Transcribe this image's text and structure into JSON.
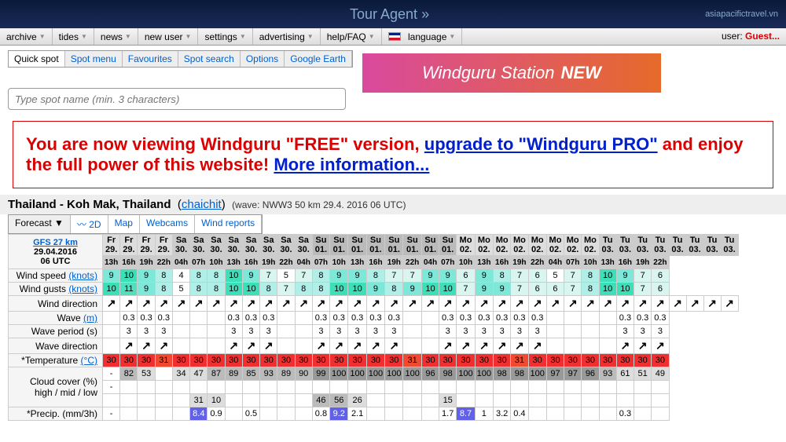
{
  "top": {
    "tour": "Tour Agent »",
    "sponsor": "asiapacifictravel.vn"
  },
  "menu": {
    "items": [
      "archive",
      "tides",
      "news",
      "new user",
      "settings",
      "advertising",
      "help/FAQ"
    ],
    "lang": "language",
    "user_label": "user: ",
    "guest": "Guest..."
  },
  "tabs": [
    "Quick spot",
    "Spot menu",
    "Favourites",
    "Spot search",
    "Options",
    "Google Earth"
  ],
  "search": {
    "placeholder": "Type spot name (min. 3 characters)"
  },
  "station": {
    "text": "Windguru Station",
    "new": "NEW"
  },
  "promo": {
    "p1": "You are now viewing Windguru \"FREE\" version, ",
    "link1": "upgrade to \"Windguru PRO\"",
    "p2": " and enjoy the full power of this website! ",
    "link2": "More information..."
  },
  "location": {
    "region": "Thailand - Koh Mak, Thailand",
    "user": "chaichit",
    "wave": "(wave: NWW3 50 km 29.4. 2016 06 UTC)"
  },
  "fctabs": [
    "Forecast",
    "2D",
    "Map",
    "Webcams",
    "Wind reports"
  ],
  "model": {
    "name": "GFS 27 km",
    "date": "29.04.2016",
    "time": "06 UTC"
  },
  "days": [
    {
      "d": "Fr",
      "n": "29.",
      "cls": ""
    },
    {
      "d": "Fr",
      "n": "29.",
      "cls": ""
    },
    {
      "d": "Fr",
      "n": "29.",
      "cls": ""
    },
    {
      "d": "Fr",
      "n": "29.",
      "cls": ""
    },
    {
      "d": "Sa",
      "n": "30.",
      "cls": "sat"
    },
    {
      "d": "Sa",
      "n": "30.",
      "cls": "sat"
    },
    {
      "d": "Sa",
      "n": "30.",
      "cls": "sat"
    },
    {
      "d": "Sa",
      "n": "30.",
      "cls": "sat"
    },
    {
      "d": "Sa",
      "n": "30.",
      "cls": "sat"
    },
    {
      "d": "Sa",
      "n": "30.",
      "cls": "sat"
    },
    {
      "d": "Sa",
      "n": "30.",
      "cls": "sat"
    },
    {
      "d": "Sa",
      "n": "30.",
      "cls": "sat"
    },
    {
      "d": "Su",
      "n": "01.",
      "cls": "sun"
    },
    {
      "d": "Su",
      "n": "01.",
      "cls": "sun"
    },
    {
      "d": "Su",
      "n": "01.",
      "cls": "sun"
    },
    {
      "d": "Su",
      "n": "01.",
      "cls": "sun"
    },
    {
      "d": "Su",
      "n": "01.",
      "cls": "sun"
    },
    {
      "d": "Su",
      "n": "01.",
      "cls": "sun"
    },
    {
      "d": "Su",
      "n": "01.",
      "cls": "sun"
    },
    {
      "d": "Su",
      "n": "01.",
      "cls": "sun"
    },
    {
      "d": "Mo",
      "n": "02.",
      "cls": ""
    },
    {
      "d": "Mo",
      "n": "02.",
      "cls": ""
    },
    {
      "d": "Mo",
      "n": "02.",
      "cls": ""
    },
    {
      "d": "Mo",
      "n": "02.",
      "cls": ""
    },
    {
      "d": "Mo",
      "n": "02.",
      "cls": ""
    },
    {
      "d": "Mo",
      "n": "02.",
      "cls": ""
    },
    {
      "d": "Mo",
      "n": "02.",
      "cls": ""
    },
    {
      "d": "Mo",
      "n": "02.",
      "cls": ""
    },
    {
      "d": "Tu",
      "n": "03.",
      "cls": "sat"
    },
    {
      "d": "Tu",
      "n": "03.",
      "cls": "sat"
    },
    {
      "d": "Tu",
      "n": "03.",
      "cls": "sat"
    },
    {
      "d": "Tu",
      "n": "03.",
      "cls": "sat"
    },
    {
      "d": "Tu",
      "n": "03.",
      "cls": "sat"
    },
    {
      "d": "Tu",
      "n": "03.",
      "cls": "sat"
    },
    {
      "d": "Tu",
      "n": "03.",
      "cls": "sat"
    },
    {
      "d": "Tu",
      "n": "03.",
      "cls": "sat"
    }
  ],
  "hours": [
    "13h",
    "16h",
    "19h",
    "22h",
    "04h",
    "07h",
    "10h",
    "13h",
    "16h",
    "19h",
    "22h",
    "04h",
    "07h",
    "10h",
    "13h",
    "16h",
    "19h",
    "22h",
    "04h",
    "07h",
    "10h",
    "13h",
    "16h",
    "19h",
    "22h",
    "04h",
    "07h",
    "10h",
    "13h",
    "16h",
    "19h",
    "22h"
  ],
  "rows": {
    "wspd": {
      "label": "Wind speed ",
      "unit": "(knots)",
      "v": [
        {
          "t": "9",
          "c": "c-cyan"
        },
        {
          "t": "10",
          "c": "c-teal"
        },
        {
          "t": "9",
          "c": "c-cyan"
        },
        {
          "t": "8",
          "c": "c-cyan2"
        },
        {
          "t": "4",
          "c": "c-none"
        },
        {
          "t": "8",
          "c": "c-cyan2"
        },
        {
          "t": "8",
          "c": "c-cyan2"
        },
        {
          "t": "10",
          "c": "c-teal"
        },
        {
          "t": "9",
          "c": "c-cyan"
        },
        {
          "t": "7",
          "c": "c-lcyan"
        },
        {
          "t": "5",
          "c": "c-none"
        },
        {
          "t": "7",
          "c": "c-lcyan"
        },
        {
          "t": "8",
          "c": "c-cyan2"
        },
        {
          "t": "9",
          "c": "c-cyan"
        },
        {
          "t": "9",
          "c": "c-cyan"
        },
        {
          "t": "8",
          "c": "c-cyan2"
        },
        {
          "t": "7",
          "c": "c-lcyan"
        },
        {
          "t": "7",
          "c": "c-lcyan"
        },
        {
          "t": "9",
          "c": "c-cyan"
        },
        {
          "t": "9",
          "c": "c-cyan"
        },
        {
          "t": "6",
          "c": "c-lcyan"
        },
        {
          "t": "9",
          "c": "c-cyan"
        },
        {
          "t": "8",
          "c": "c-cyan2"
        },
        {
          "t": "7",
          "c": "c-lcyan"
        },
        {
          "t": "6",
          "c": "c-lcyan"
        },
        {
          "t": "5",
          "c": "c-none"
        },
        {
          "t": "7",
          "c": "c-lcyan"
        },
        {
          "t": "8",
          "c": "c-cyan2"
        },
        {
          "t": "10",
          "c": "c-teal"
        },
        {
          "t": "9",
          "c": "c-cyan"
        },
        {
          "t": "7",
          "c": "c-lcyan"
        },
        {
          "t": "6",
          "c": "c-lcyan"
        }
      ]
    },
    "wgust": {
      "label": "Wind gusts ",
      "unit": "(knots)",
      "v": [
        {
          "t": "10",
          "c": "c-teal"
        },
        {
          "t": "11",
          "c": "c-teal2"
        },
        {
          "t": "9",
          "c": "c-cyan"
        },
        {
          "t": "8",
          "c": "c-cyan2"
        },
        {
          "t": "5",
          "c": "c-none"
        },
        {
          "t": "8",
          "c": "c-cyan2"
        },
        {
          "t": "8",
          "c": "c-cyan2"
        },
        {
          "t": "10",
          "c": "c-teal"
        },
        {
          "t": "10",
          "c": "c-teal"
        },
        {
          "t": "8",
          "c": "c-cyan2"
        },
        {
          "t": "7",
          "c": "c-lcyan"
        },
        {
          "t": "8",
          "c": "c-cyan2"
        },
        {
          "t": "8",
          "c": "c-cyan2"
        },
        {
          "t": "10",
          "c": "c-teal"
        },
        {
          "t": "10",
          "c": "c-teal"
        },
        {
          "t": "9",
          "c": "c-cyan"
        },
        {
          "t": "8",
          "c": "c-cyan2"
        },
        {
          "t": "9",
          "c": "c-cyan"
        },
        {
          "t": "10",
          "c": "c-teal"
        },
        {
          "t": "10",
          "c": "c-teal"
        },
        {
          "t": "7",
          "c": "c-lcyan"
        },
        {
          "t": "9",
          "c": "c-cyan"
        },
        {
          "t": "9",
          "c": "c-cyan"
        },
        {
          "t": "7",
          "c": "c-lcyan"
        },
        {
          "t": "6",
          "c": "c-lcyan"
        },
        {
          "t": "6",
          "c": "c-lcyan"
        },
        {
          "t": "7",
          "c": "c-lcyan"
        },
        {
          "t": "8",
          "c": "c-cyan2"
        },
        {
          "t": "10",
          "c": "c-teal"
        },
        {
          "t": "10",
          "c": "c-teal"
        },
        {
          "t": "7",
          "c": "c-lcyan"
        },
        {
          "t": "6",
          "c": "c-lcyan"
        }
      ]
    },
    "wdir": {
      "label": "Wind direction"
    },
    "wave": {
      "label": "Wave ",
      "unit": "(m)",
      "v": [
        "",
        "0.3",
        "0.3",
        "0.3",
        "",
        "",
        "",
        "0.3",
        "0.3",
        "0.3",
        "",
        "",
        "0.3",
        "0.3",
        "0.3",
        "0.3",
        "0.3",
        "",
        "",
        "0.3",
        "0.3",
        "0.3",
        "0.3",
        "0.3",
        "0.3",
        "",
        "",
        "",
        "",
        "0.3",
        "0.3",
        "0.3"
      ]
    },
    "wper": {
      "label": "Wave period (s)",
      "v": [
        "",
        "3",
        "3",
        "3",
        "",
        "",
        "",
        "3",
        "3",
        "3",
        "",
        "",
        "3",
        "3",
        "3",
        "3",
        "3",
        "",
        "",
        "3",
        "3",
        "3",
        "3",
        "3",
        "3",
        "",
        "",
        "",
        "",
        "3",
        "3",
        "3"
      ]
    },
    "wvdir": {
      "label": "Wave direction"
    },
    "temp": {
      "label": "*Temperature ",
      "unit": "(°C)",
      "v": [
        {
          "t": "30",
          "c": "c-red"
        },
        {
          "t": "30",
          "c": "c-red"
        },
        {
          "t": "30",
          "c": "c-red"
        },
        {
          "t": "31",
          "c": "c-red2"
        },
        {
          "t": "30",
          "c": "c-red"
        },
        {
          "t": "30",
          "c": "c-red"
        },
        {
          "t": "30",
          "c": "c-red"
        },
        {
          "t": "30",
          "c": "c-red"
        },
        {
          "t": "30",
          "c": "c-red"
        },
        {
          "t": "30",
          "c": "c-red"
        },
        {
          "t": "30",
          "c": "c-red"
        },
        {
          "t": "30",
          "c": "c-red"
        },
        {
          "t": "30",
          "c": "c-red"
        },
        {
          "t": "30",
          "c": "c-red"
        },
        {
          "t": "30",
          "c": "c-red"
        },
        {
          "t": "30",
          "c": "c-red"
        },
        {
          "t": "30",
          "c": "c-red"
        },
        {
          "t": "31",
          "c": "c-red2"
        },
        {
          "t": "30",
          "c": "c-red"
        },
        {
          "t": "30",
          "c": "c-red"
        },
        {
          "t": "30",
          "c": "c-red"
        },
        {
          "t": "30",
          "c": "c-red"
        },
        {
          "t": "30",
          "c": "c-red"
        },
        {
          "t": "31",
          "c": "c-red2"
        },
        {
          "t": "30",
          "c": "c-red"
        },
        {
          "t": "30",
          "c": "c-red"
        },
        {
          "t": "30",
          "c": "c-red"
        },
        {
          "t": "30",
          "c": "c-red"
        },
        {
          "t": "30",
          "c": "c-red"
        },
        {
          "t": "30",
          "c": "c-red"
        },
        {
          "t": "30",
          "c": "c-red"
        },
        {
          "t": "30",
          "c": "c-red"
        }
      ]
    },
    "cloud_label": "Cloud cover (%)\nhigh / mid / low",
    "cloud_high": [
      "-",
      "82",
      "53",
      "",
      "34",
      "47",
      "87",
      "89",
      "85",
      "93",
      "89",
      "90",
      "99",
      "100",
      "100",
      "100",
      "100",
      "100",
      "96",
      "98",
      "100",
      "100",
      "98",
      "98",
      "100",
      "97",
      "97",
      "96",
      "93",
      "61",
      "51",
      "49"
    ],
    "cloud_mid": [
      "-",
      "",
      "",
      "",
      "",
      "",
      "",
      "",
      "",
      "",
      "",
      "",
      "",
      "",
      "",
      "",
      "",
      "",
      "",
      "",
      "",
      "",
      "",
      "",
      "",
      "",
      "",
      "",
      "",
      "",
      "",
      ""
    ],
    "cloud_low": [
      "",
      "",
      "",
      "",
      "",
      "31",
      "10",
      "",
      "",
      "",
      "",
      "",
      "46",
      "56",
      "26",
      "",
      "",
      "",
      "",
      "15",
      "",
      "",
      "",
      "",
      "",
      "",
      "",
      "",
      "",
      "",
      "",
      ""
    ],
    "precip": {
      "label": "*Precip. (mm/3h)",
      "v": [
        {
          "t": "-",
          "c": ""
        },
        {
          "t": "",
          "c": ""
        },
        {
          "t": "",
          "c": ""
        },
        {
          "t": "",
          "c": ""
        },
        {
          "t": "",
          "c": ""
        },
        {
          "t": "8.4",
          "c": "c-blue"
        },
        {
          "t": "0.9",
          "c": ""
        },
        {
          "t": "",
          "c": ""
        },
        {
          "t": "0.5",
          "c": ""
        },
        {
          "t": "",
          "c": ""
        },
        {
          "t": "",
          "c": ""
        },
        {
          "t": "",
          "c": ""
        },
        {
          "t": "0.8",
          "c": ""
        },
        {
          "t": "9.2",
          "c": "c-blue"
        },
        {
          "t": "2.1",
          "c": ""
        },
        {
          "t": "",
          "c": ""
        },
        {
          "t": "",
          "c": ""
        },
        {
          "t": "",
          "c": ""
        },
        {
          "t": "",
          "c": ""
        },
        {
          "t": "1.7",
          "c": ""
        },
        {
          "t": "8.7",
          "c": "c-blue"
        },
        {
          "t": "1",
          "c": ""
        },
        {
          "t": "3.2",
          "c": ""
        },
        {
          "t": "0.4",
          "c": ""
        },
        {
          "t": "",
          "c": ""
        },
        {
          "t": "",
          "c": ""
        },
        {
          "t": "",
          "c": ""
        },
        {
          "t": "",
          "c": ""
        },
        {
          "t": "",
          "c": ""
        },
        {
          "t": "0.3",
          "c": ""
        },
        {
          "t": "",
          "c": ""
        },
        {
          "t": "",
          "c": ""
        }
      ]
    }
  }
}
